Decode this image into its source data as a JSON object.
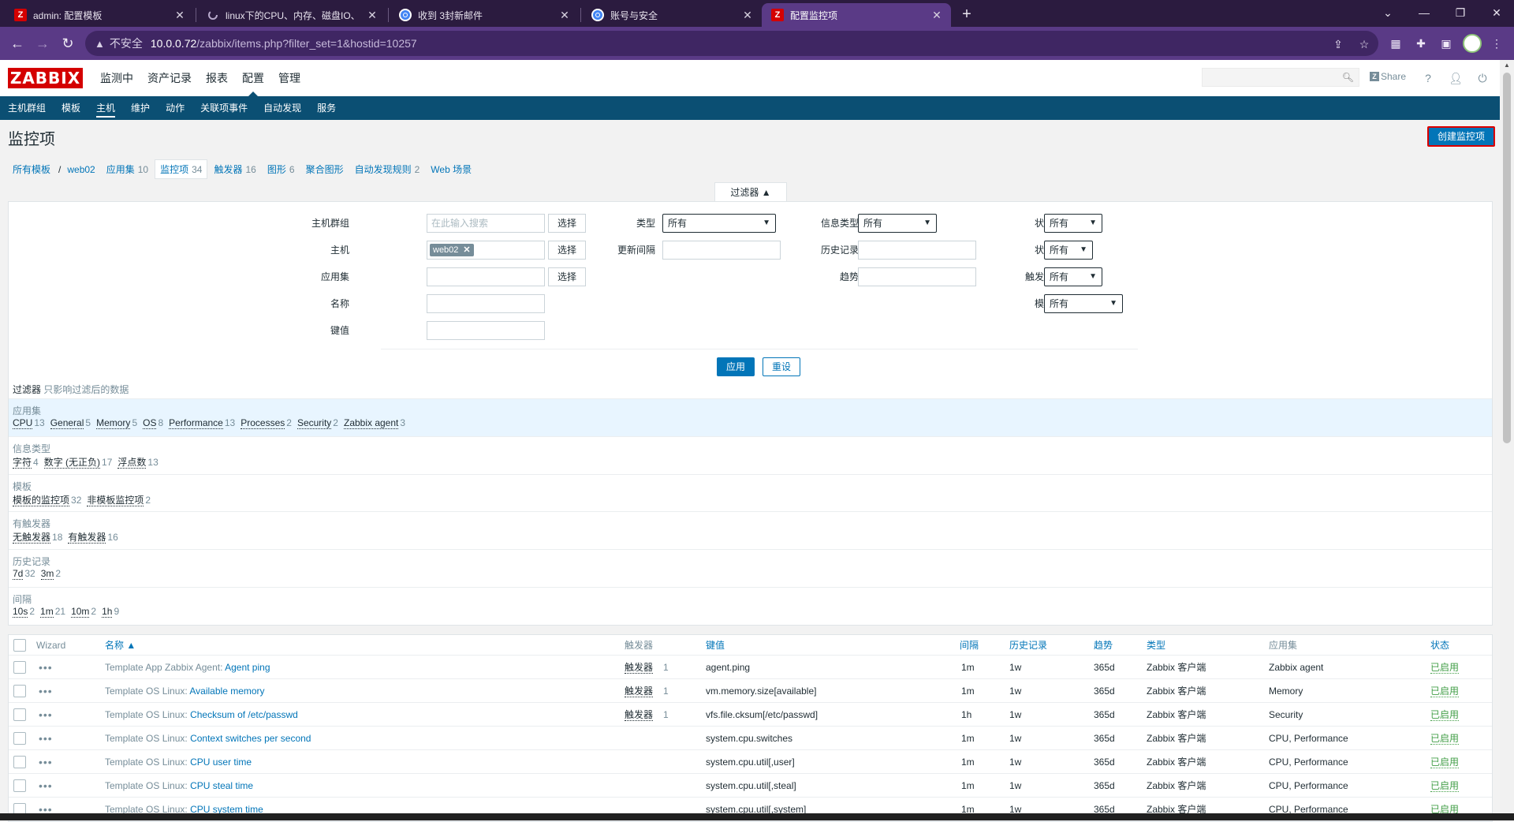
{
  "browser": {
    "tabs": [
      {
        "title": "admin: 配置模板",
        "favicon": "zabbix-z"
      },
      {
        "title": "linux下的CPU、内存、磁盘IO、",
        "favicon": "loading"
      },
      {
        "title": "收到 3封新邮件",
        "favicon": "chrome"
      },
      {
        "title": "账号与安全",
        "favicon": "chrome"
      },
      {
        "title": "配置监控项",
        "favicon": "zabbix-z"
      }
    ],
    "active_tab": 4,
    "address": {
      "warning": "不安全",
      "host": "10.0.0.72",
      "path": "/zabbix/items.php?filter_set=1&hostid=10257"
    },
    "colors": {
      "frame": "#2b1b3f",
      "toolbar": "#5a3a86"
    }
  },
  "header": {
    "logo": "ZABBIX",
    "menu": [
      "监测中",
      "资产记录",
      "报表",
      "配置",
      "管理"
    ],
    "menu_selected": 3,
    "share": "Share",
    "help": "?",
    "colors": {
      "logo": "#d40000",
      "submenu": "#0b4f73",
      "link": "#0275b8"
    }
  },
  "submenu": {
    "items": [
      "主机群组",
      "模板",
      "主机",
      "维护",
      "动作",
      "关联项事件",
      "自动发现",
      "服务"
    ],
    "selected": 2
  },
  "page": {
    "title": "监控项",
    "create_button": "创建监控项"
  },
  "breadcrumb": {
    "all_templates": "所有模板",
    "host": "web02",
    "tabs": [
      {
        "label": "应用集",
        "count": "10"
      },
      {
        "label": "监控项",
        "count": "34"
      },
      {
        "label": "触发器",
        "count": "16"
      },
      {
        "label": "图形",
        "count": "6"
      },
      {
        "label": "聚合图形",
        "count": ""
      },
      {
        "label": "自动发现规则",
        "count": "2"
      },
      {
        "label": "Web 场景",
        "count": ""
      }
    ],
    "selected": 1
  },
  "filter": {
    "tab_label": "过滤器 ▲",
    "labels": {
      "hostgroup": "主机群组",
      "host": "主机",
      "application": "应用集",
      "name": "名称",
      "key": "键值",
      "type": "类型",
      "interval": "更新间隔",
      "info_type": "信息类型",
      "history": "历史记录",
      "trends": "趋势",
      "state": "状态",
      "status": "状态",
      "triggers": "触发器",
      "template": "模板"
    },
    "hostgroup_placeholder": "在此输入搜索",
    "select_button": "选择",
    "host_chip": "web02",
    "selects": {
      "type": "所有",
      "info_type": "所有",
      "state": "所有",
      "status": "所有",
      "triggers": "所有",
      "template": "所有"
    },
    "apply": "应用",
    "reset": "重设"
  },
  "subfilter": {
    "title": "过滤器",
    "hint": "只影响过滤后的数据",
    "groups": [
      {
        "name": "应用集",
        "items": [
          {
            "label": "CPU",
            "count": "13"
          },
          {
            "label": "General",
            "count": "5"
          },
          {
            "label": "Memory",
            "count": "5"
          },
          {
            "label": "OS",
            "count": "8"
          },
          {
            "label": "Performance",
            "count": "13"
          },
          {
            "label": "Processes",
            "count": "2"
          },
          {
            "label": "Security",
            "count": "2"
          },
          {
            "label": "Zabbix agent",
            "count": "3"
          }
        ]
      },
      {
        "name": "信息类型",
        "items": [
          {
            "label": "字符",
            "count": "4"
          },
          {
            "label": "数字 (无正负)",
            "count": "17"
          },
          {
            "label": "浮点数",
            "count": "13"
          }
        ]
      },
      {
        "name": "模板",
        "items": [
          {
            "label": "模板的监控项",
            "count": "32"
          },
          {
            "label": "非模板监控项",
            "count": "2"
          }
        ]
      },
      {
        "name": "有触发器",
        "items": [
          {
            "label": "无触发器",
            "count": "18"
          },
          {
            "label": "有触发器",
            "count": "16"
          }
        ]
      },
      {
        "name": "历史记录",
        "items": [
          {
            "label": "7d",
            "count": "32"
          },
          {
            "label": "3m",
            "count": "2"
          }
        ]
      },
      {
        "name": "间隔",
        "items": [
          {
            "label": "10s",
            "count": "2"
          },
          {
            "label": "1m",
            "count": "21"
          },
          {
            "label": "10m",
            "count": "2"
          },
          {
            "label": "1h",
            "count": "9"
          }
        ]
      }
    ]
  },
  "table": {
    "headers": {
      "wizard": "Wizard",
      "name": "名称 ▲",
      "triggers": "触发器",
      "key": "键值",
      "interval": "间隔",
      "history": "历史记录",
      "trends": "趋势",
      "type": "类型",
      "applications": "应用集",
      "status": "状态"
    },
    "rows": [
      {
        "template": "Template App Zabbix Agent:",
        "name": "Agent ping",
        "triggers": "触发器",
        "trigger_count": "1",
        "key": "agent.ping",
        "interval": "1m",
        "history": "1w",
        "trends": "365d",
        "type": "Zabbix 客户端",
        "applications": "Zabbix agent",
        "status": "已启用"
      },
      {
        "template": "Template OS Linux:",
        "name": "Available memory",
        "triggers": "触发器",
        "trigger_count": "1",
        "key": "vm.memory.size[available]",
        "interval": "1m",
        "history": "1w",
        "trends": "365d",
        "type": "Zabbix 客户端",
        "applications": "Memory",
        "status": "已启用"
      },
      {
        "template": "Template OS Linux:",
        "name": "Checksum of /etc/passwd",
        "triggers": "触发器",
        "trigger_count": "1",
        "key": "vfs.file.cksum[/etc/passwd]",
        "interval": "1h",
        "history": "1w",
        "trends": "365d",
        "type": "Zabbix 客户端",
        "applications": "Security",
        "status": "已启用"
      },
      {
        "template": "Template OS Linux:",
        "name": "Context switches per second",
        "triggers": "",
        "trigger_count": "",
        "key": "system.cpu.switches",
        "interval": "1m",
        "history": "1w",
        "trends": "365d",
        "type": "Zabbix 客户端",
        "applications": "CPU, Performance",
        "status": "已启用"
      },
      {
        "template": "Template OS Linux:",
        "name": "CPU user time",
        "triggers": "",
        "trigger_count": "",
        "key": "system.cpu.util[,user]",
        "interval": "1m",
        "history": "1w",
        "trends": "365d",
        "type": "Zabbix 客户端",
        "applications": "CPU, Performance",
        "status": "已启用"
      },
      {
        "template": "Template OS Linux:",
        "name": "CPU steal time",
        "triggers": "",
        "trigger_count": "",
        "key": "system.cpu.util[,steal]",
        "interval": "1m",
        "history": "1w",
        "trends": "365d",
        "type": "Zabbix 客户端",
        "applications": "CPU, Performance",
        "status": "已启用"
      },
      {
        "template": "Template OS Linux:",
        "name": "CPU system time",
        "triggers": "",
        "trigger_count": "",
        "key": "system.cpu.util[,system]",
        "interval": "1m",
        "history": "1w",
        "trends": "365d",
        "type": "Zabbix 客户端",
        "applications": "CPU, Performance",
        "status": "已启用"
      }
    ]
  }
}
